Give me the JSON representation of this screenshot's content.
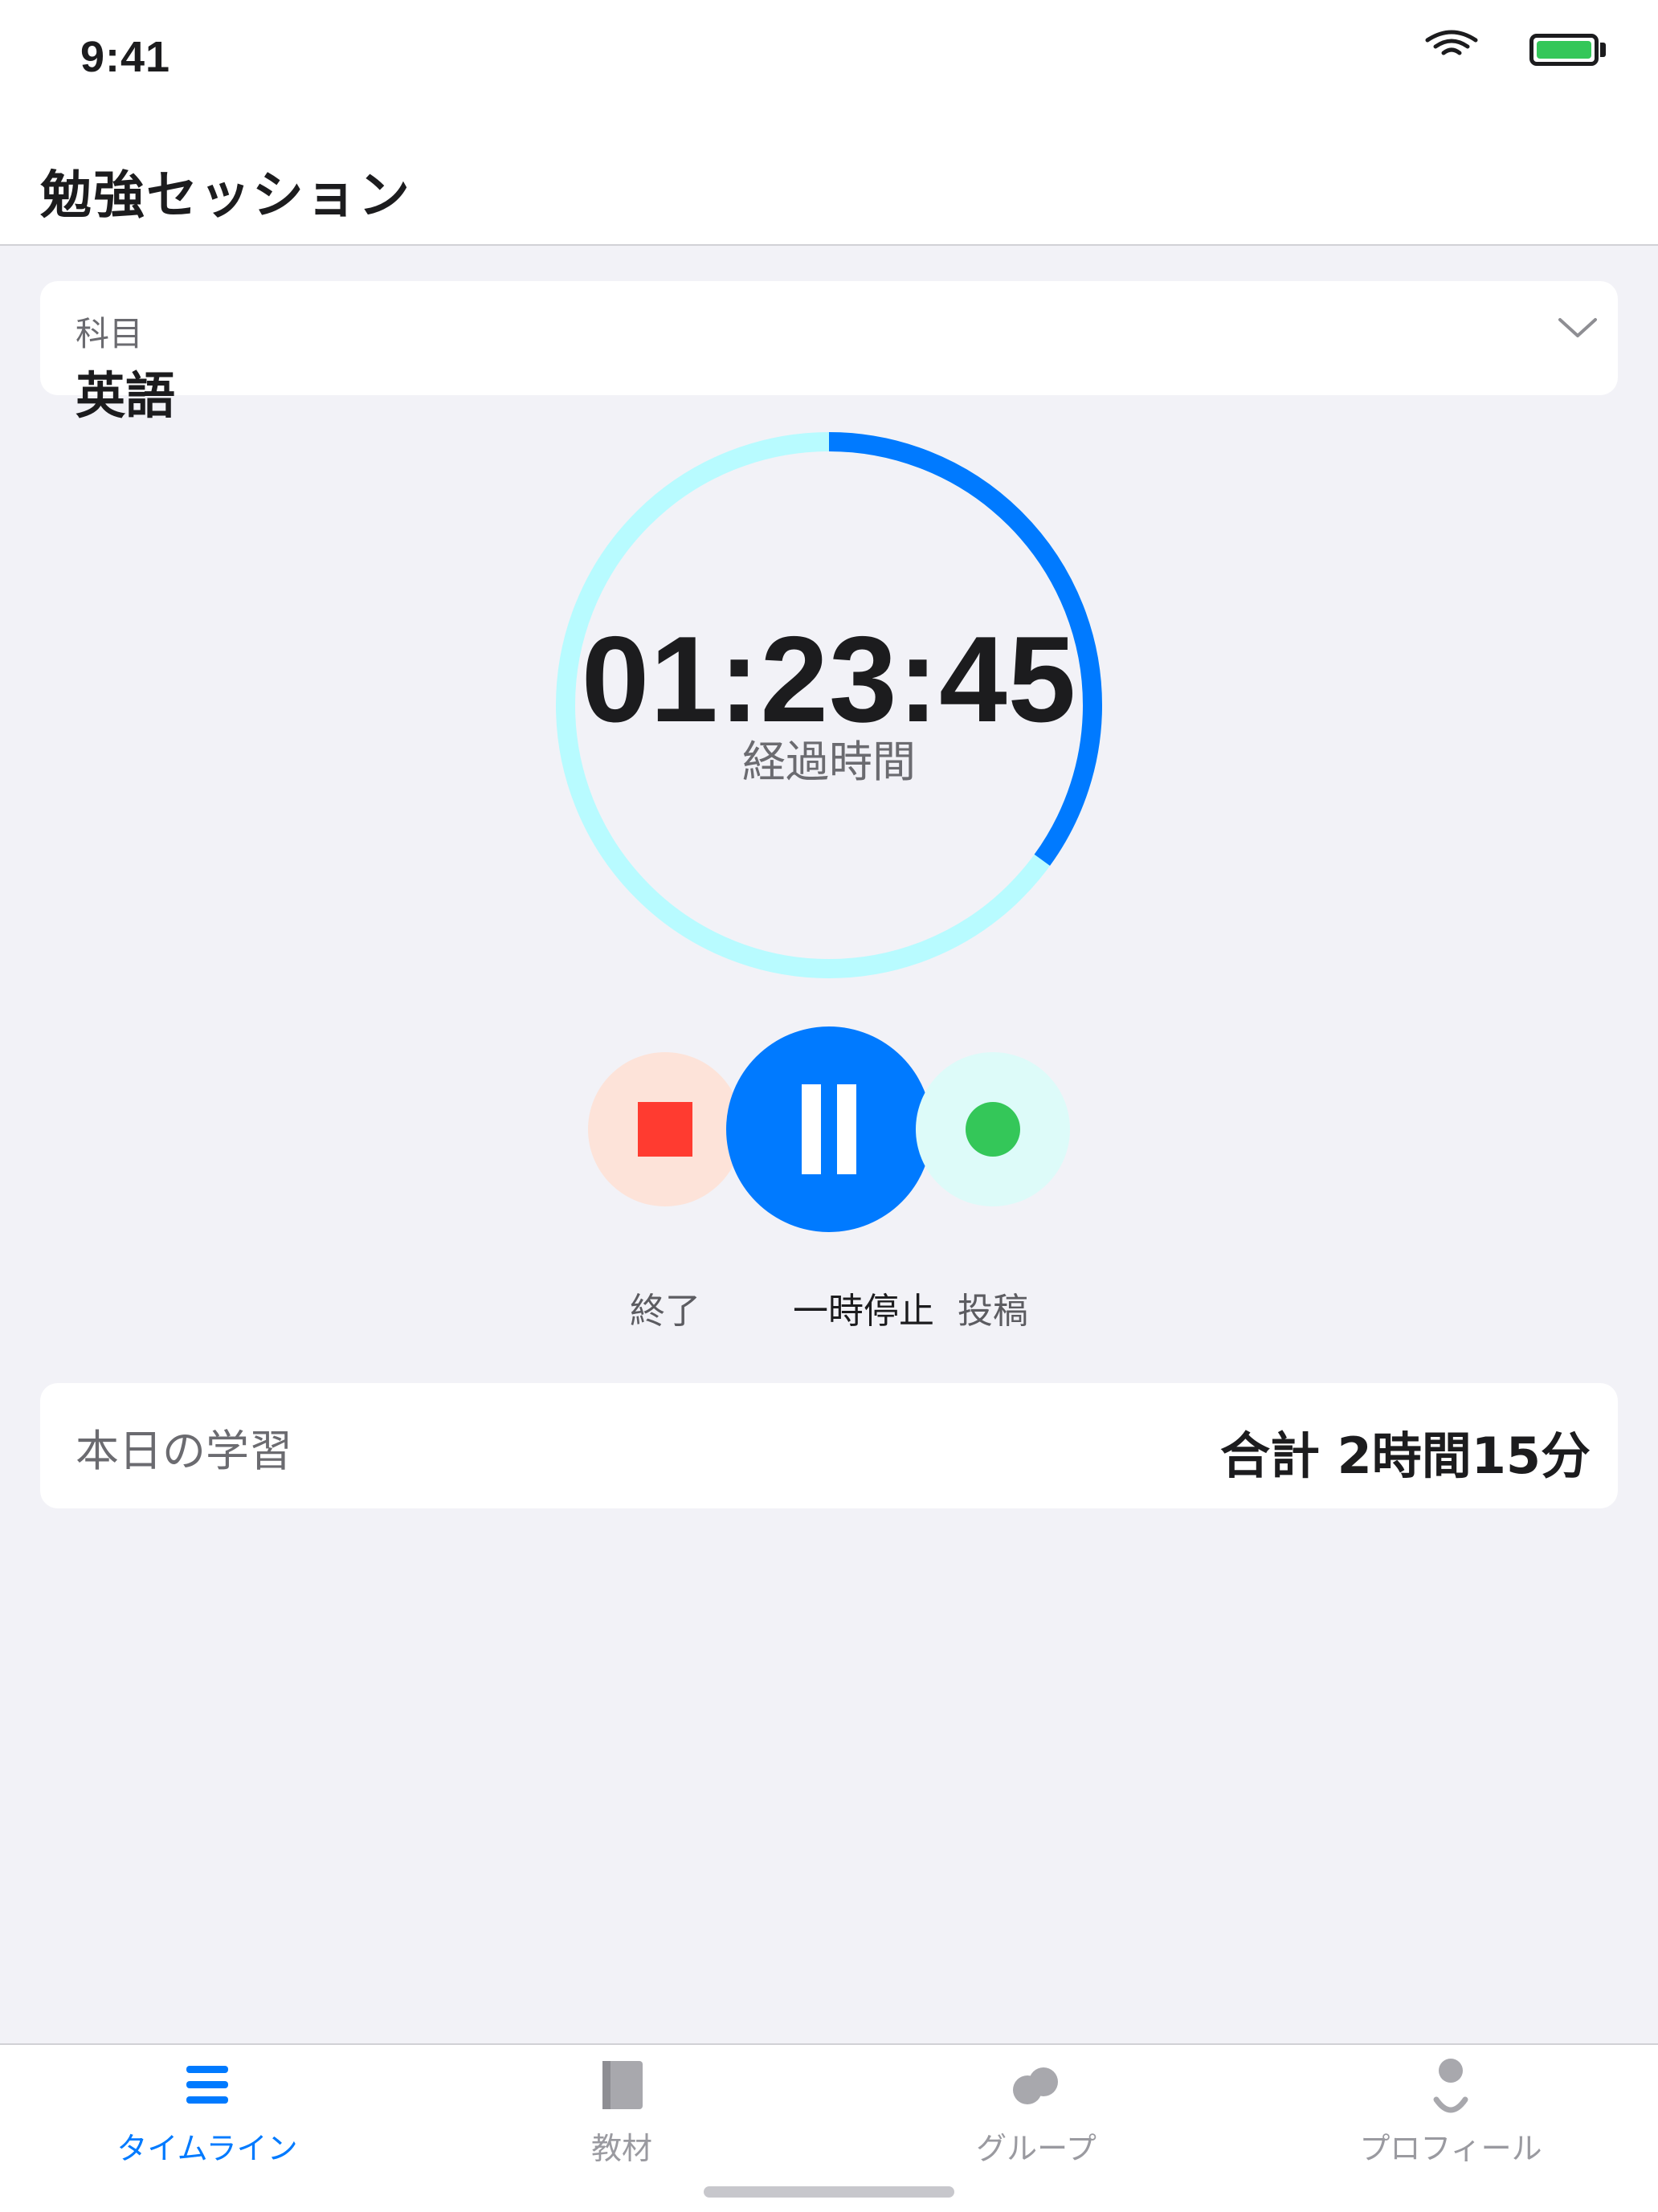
{
  "status_bar": {
    "time": "9:41",
    "battery_color": "#34c759"
  },
  "header": {
    "title": "勉強セッション"
  },
  "subject": {
    "label": "科目",
    "value": "英語"
  },
  "timer": {
    "elapsed": "01:23:45",
    "caption": "経過時間",
    "progress_fraction": 0.35,
    "ring_track_color": "#b8fbff",
    "ring_progress_color": "#007aff"
  },
  "controls": {
    "stop_label": "終了",
    "pause_label": "一時停止",
    "post_label": "投稿"
  },
  "today": {
    "label": "本日の学習",
    "total": "合計 2時間15分"
  },
  "tabbar": {
    "items": [
      {
        "label": "タイムライン",
        "icon": "list-icon",
        "active": true
      },
      {
        "label": "教材",
        "icon": "book-icon",
        "active": false
      },
      {
        "label": "グループ",
        "icon": "group-icon",
        "active": false
      },
      {
        "label": "プロフィール",
        "icon": "person-icon",
        "active": false
      }
    ]
  },
  "colors": {
    "accent": "#007aff",
    "stop": "#ff3b30",
    "post": "#34c759",
    "background": "#f2f2f7"
  }
}
